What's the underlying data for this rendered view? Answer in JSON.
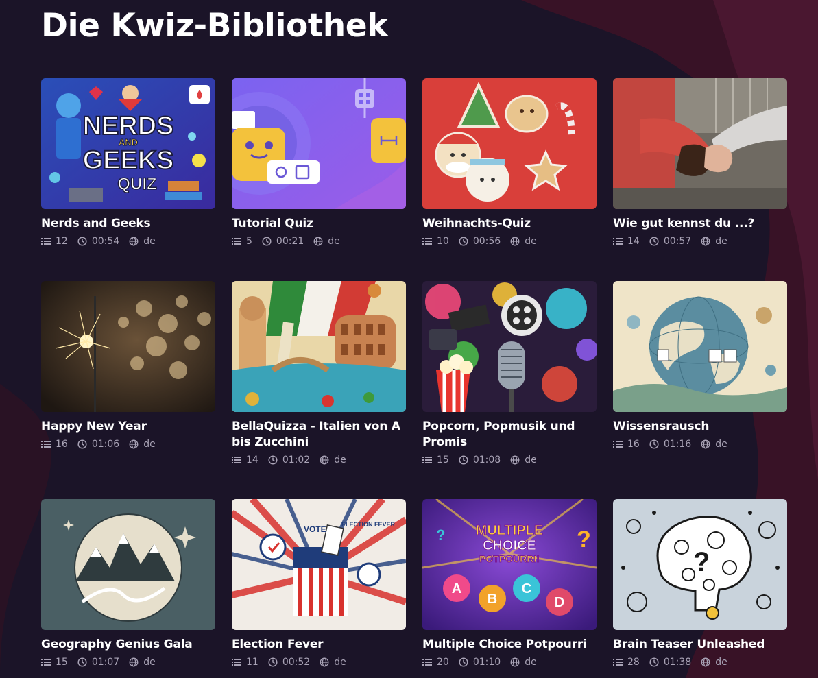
{
  "page": {
    "title": "Die Kwiz-Bibliothek"
  },
  "colors": {
    "background": "#1b1428",
    "wave": "#4a1730",
    "meta_text": "#a9a3b6"
  },
  "icons": {
    "questions": "list-icon",
    "duration": "clock-icon",
    "language": "globe-icon"
  },
  "quizzes": [
    {
      "title": "Nerds and Geeks",
      "questions": "12",
      "duration": "00:54",
      "language": "de",
      "image": "nerds-geeks-cover",
      "thumb_text": {
        "line1": "NERDS",
        "line2": "AND",
        "line3": "GEEKS",
        "line4": "QUIZ"
      }
    },
    {
      "title": "Tutorial Quiz",
      "questions": "5",
      "duration": "00:21",
      "language": "de",
      "image": "tutorial-cover"
    },
    {
      "title": "Weihnachts-Quiz",
      "questions": "10",
      "duration": "00:56",
      "language": "de",
      "image": "christmas-cookies"
    },
    {
      "title": "Wie gut kennst du ...?",
      "questions": "14",
      "duration": "00:57",
      "language": "de",
      "image": "fist-bump"
    },
    {
      "title": "Happy New Year",
      "questions": "16",
      "duration": "01:06",
      "language": "de",
      "image": "sparkler-bokeh"
    },
    {
      "title": "BellaQuizza - Italien von A bis Zucchini",
      "questions": "14",
      "duration": "01:02",
      "language": "de",
      "image": "italy-landmarks"
    },
    {
      "title": "Popcorn, Popmusik und Promis",
      "questions": "15",
      "duration": "01:08",
      "language": "de",
      "image": "pop-culture-collage"
    },
    {
      "title": "Wissensrausch",
      "questions": "16",
      "duration": "01:16",
      "language": "de",
      "image": "globe-science"
    },
    {
      "title": "Geography Genius Gala",
      "questions": "15",
      "duration": "01:07",
      "language": "de",
      "image": "mountain-globe"
    },
    {
      "title": "Election Fever",
      "questions": "11",
      "duration": "00:52",
      "language": "de",
      "image": "ballot-box",
      "thumb_text": {
        "vote": "VOTE",
        "fever": "ELECTION FEVER"
      }
    },
    {
      "title": "Multiple Choice Potpourri",
      "questions": "20",
      "duration": "01:10",
      "language": "de",
      "image": "abcd-balloons",
      "thumb_text": {
        "line1": "MULTIPLE",
        "line2": "CHOICE",
        "line3": "POTPOURRI!"
      }
    },
    {
      "title": "Brain Teaser Unleashed",
      "questions": "28",
      "duration": "01:38",
      "language": "de",
      "image": "brain-doodle"
    }
  ]
}
